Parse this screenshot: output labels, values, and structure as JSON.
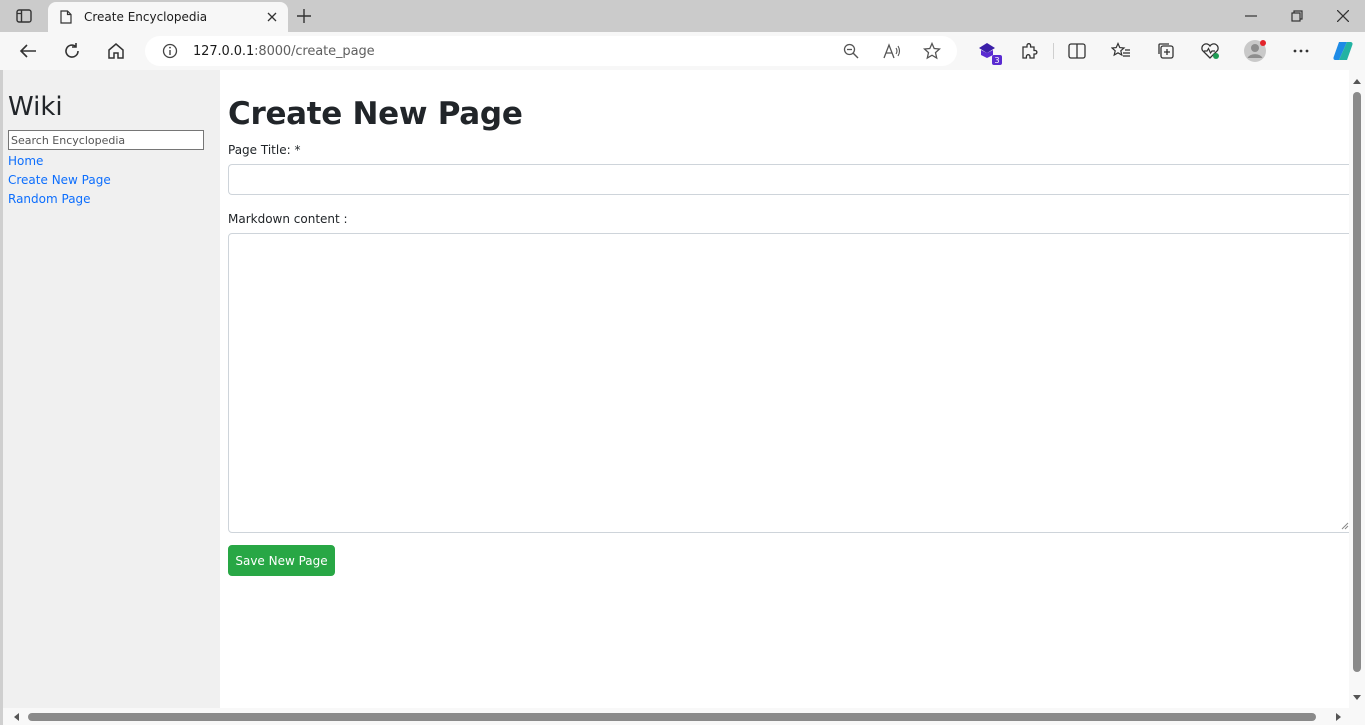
{
  "browser": {
    "tab": {
      "title": "Create Encyclopedia"
    },
    "address": {
      "host": "127.0.0.1",
      "rest": ":8000/create_page"
    },
    "extensions_badge": "3"
  },
  "sidebar": {
    "title": "Wiki",
    "search_placeholder": "Search Encyclopedia",
    "links": [
      "Home",
      "Create New Page",
      "Random Page"
    ]
  },
  "form": {
    "heading": "Create New Page",
    "title_label": "Page Title: *",
    "title_value": "",
    "content_label": "Markdown content :",
    "content_value": "",
    "submit_label": "Save New Page"
  },
  "colors": {
    "link": "#0d6efd",
    "button": "#28a745",
    "sidebar_bg": "#f0f0f0"
  }
}
